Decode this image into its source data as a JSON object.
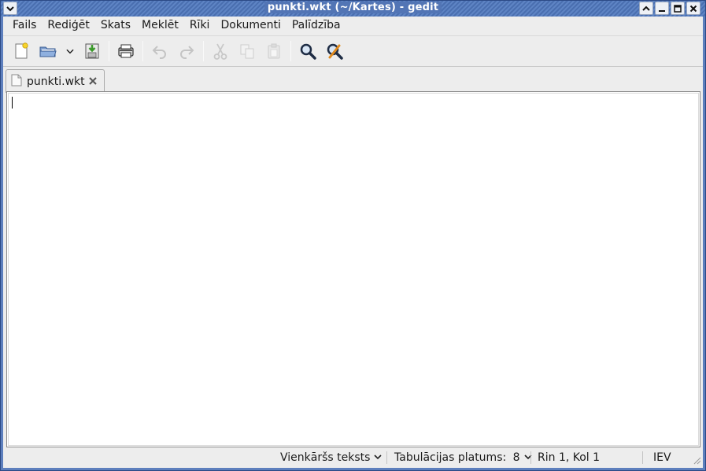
{
  "window": {
    "title": "punkti.wkt (~/Kartes) - gedit",
    "accent": "#5d7fbd"
  },
  "menubar": {
    "items": [
      "Fails",
      "Rediģēt",
      "Skats",
      "Meklēt",
      "Rīki",
      "Dokumenti",
      "Palīdzība"
    ]
  },
  "toolbar": {
    "buttons": [
      {
        "name": "new-document-icon",
        "enabled": true
      },
      {
        "name": "open-folder-icon",
        "enabled": true
      },
      {
        "name": "open-recent-chevron-icon",
        "enabled": true
      },
      {
        "name": "save-icon",
        "enabled": true
      },
      {
        "name": "print-icon",
        "enabled": true
      },
      {
        "name": "undo-icon",
        "enabled": false
      },
      {
        "name": "redo-icon",
        "enabled": false
      },
      {
        "name": "cut-icon",
        "enabled": false
      },
      {
        "name": "copy-icon",
        "enabled": false
      },
      {
        "name": "paste-icon",
        "enabled": false
      },
      {
        "name": "search-icon",
        "enabled": true
      },
      {
        "name": "search-replace-icon",
        "enabled": true
      }
    ]
  },
  "tabs": [
    {
      "label": "punkti.wkt",
      "icon": "text-document-icon",
      "active": true
    }
  ],
  "editor": {
    "content": ""
  },
  "statusbar": {
    "language": "Vienkāršs teksts",
    "tab_width_label": "Tabulācijas platums:",
    "tab_width_value": "8",
    "cursor_position": "Rin 1, Kol 1",
    "insert_mode": "IEV"
  }
}
